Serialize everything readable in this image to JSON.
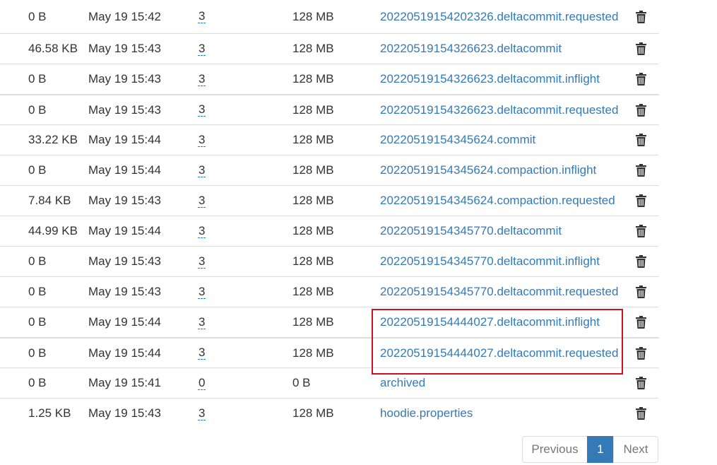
{
  "rows": [
    {
      "size": "0 B",
      "date": "May 19 15:42",
      "replication": "3",
      "block_size": "128 MB",
      "name": "20220519154202326.deltacommit.requested"
    },
    {
      "size": "46.58 KB",
      "date": "May 19 15:43",
      "replication": "3",
      "block_size": "128 MB",
      "name": "20220519154326623.deltacommit"
    },
    {
      "size": "0 B",
      "date": "May 19 15:43",
      "replication": "3",
      "block_size": "128 MB",
      "name": "20220519154326623.deltacommit.inflight"
    },
    {
      "size": "0 B",
      "date": "May 19 15:43",
      "replication": "3",
      "block_size": "128 MB",
      "name": "20220519154326623.deltacommit.requested"
    },
    {
      "size": "33.22 KB",
      "date": "May 19 15:44",
      "replication": "3",
      "block_size": "128 MB",
      "name": "20220519154345624.commit"
    },
    {
      "size": "0 B",
      "date": "May 19 15:44",
      "replication": "3",
      "block_size": "128 MB",
      "name": "20220519154345624.compaction.inflight"
    },
    {
      "size": "7.84 KB",
      "date": "May 19 15:43",
      "replication": "3",
      "block_size": "128 MB",
      "name": "20220519154345624.compaction.requested"
    },
    {
      "size": "44.99 KB",
      "date": "May 19 15:44",
      "replication": "3",
      "block_size": "128 MB",
      "name": "20220519154345770.deltacommit"
    },
    {
      "size": "0 B",
      "date": "May 19 15:43",
      "replication": "3",
      "block_size": "128 MB",
      "name": "20220519154345770.deltacommit.inflight"
    },
    {
      "size": "0 B",
      "date": "May 19 15:43",
      "replication": "3",
      "block_size": "128 MB",
      "name": "20220519154345770.deltacommit.requested"
    },
    {
      "size": "0 B",
      "date": "May 19 15:44",
      "replication": "3",
      "block_size": "128 MB",
      "name": "20220519154444027.deltacommit.inflight"
    },
    {
      "size": "0 B",
      "date": "May 19 15:44",
      "replication": "3",
      "block_size": "128 MB",
      "name": "20220519154444027.deltacommit.requested"
    },
    {
      "size": "0 B",
      "date": "May 19 15:41",
      "replication": "0",
      "block_size": "0 B",
      "name": "archived"
    },
    {
      "size": "1.25 KB",
      "date": "May 19 15:43",
      "replication": "3",
      "block_size": "128 MB",
      "name": "hoodie.properties"
    }
  ],
  "pagination": {
    "previous": "Previous",
    "current": "1",
    "next": "Next"
  },
  "colors": {
    "link": "#337ab7",
    "highlight_border": "#cc1122",
    "active_page": "#337ab7"
  },
  "icons": {
    "delete": "trash-icon"
  }
}
